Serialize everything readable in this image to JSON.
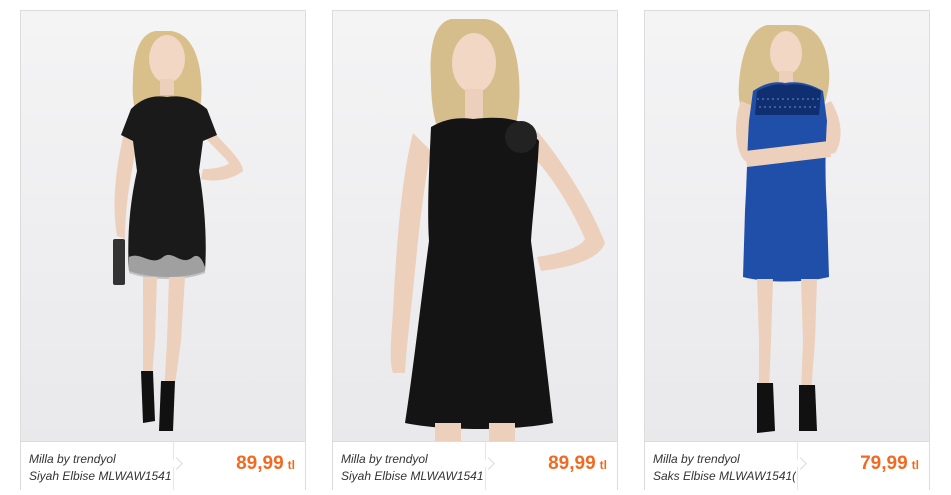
{
  "products": [
    {
      "brand": "Milla by trendyol",
      "title": "Siyah Elbise MLWAW1541",
      "price": "89,99",
      "currency": "tl",
      "dress_color": "#1a1a1a",
      "image": "model-black-short-sleeve-dress"
    },
    {
      "brand": "Milla by trendyol",
      "title": "Siyah Elbise MLWAW1541",
      "price": "89,99",
      "currency": "tl",
      "dress_color": "#141414",
      "image": "model-black-sleeveless-dress"
    },
    {
      "brand": "Milla by trendyol",
      "title": "Saks Elbise MLWAW1541(",
      "price": "79,99",
      "currency": "tl",
      "dress_color": "#1f4fa8",
      "image": "model-blue-dress-lace-yoke"
    }
  ],
  "colors": {
    "price": "#f26a21",
    "border": "#dcdcdc"
  }
}
